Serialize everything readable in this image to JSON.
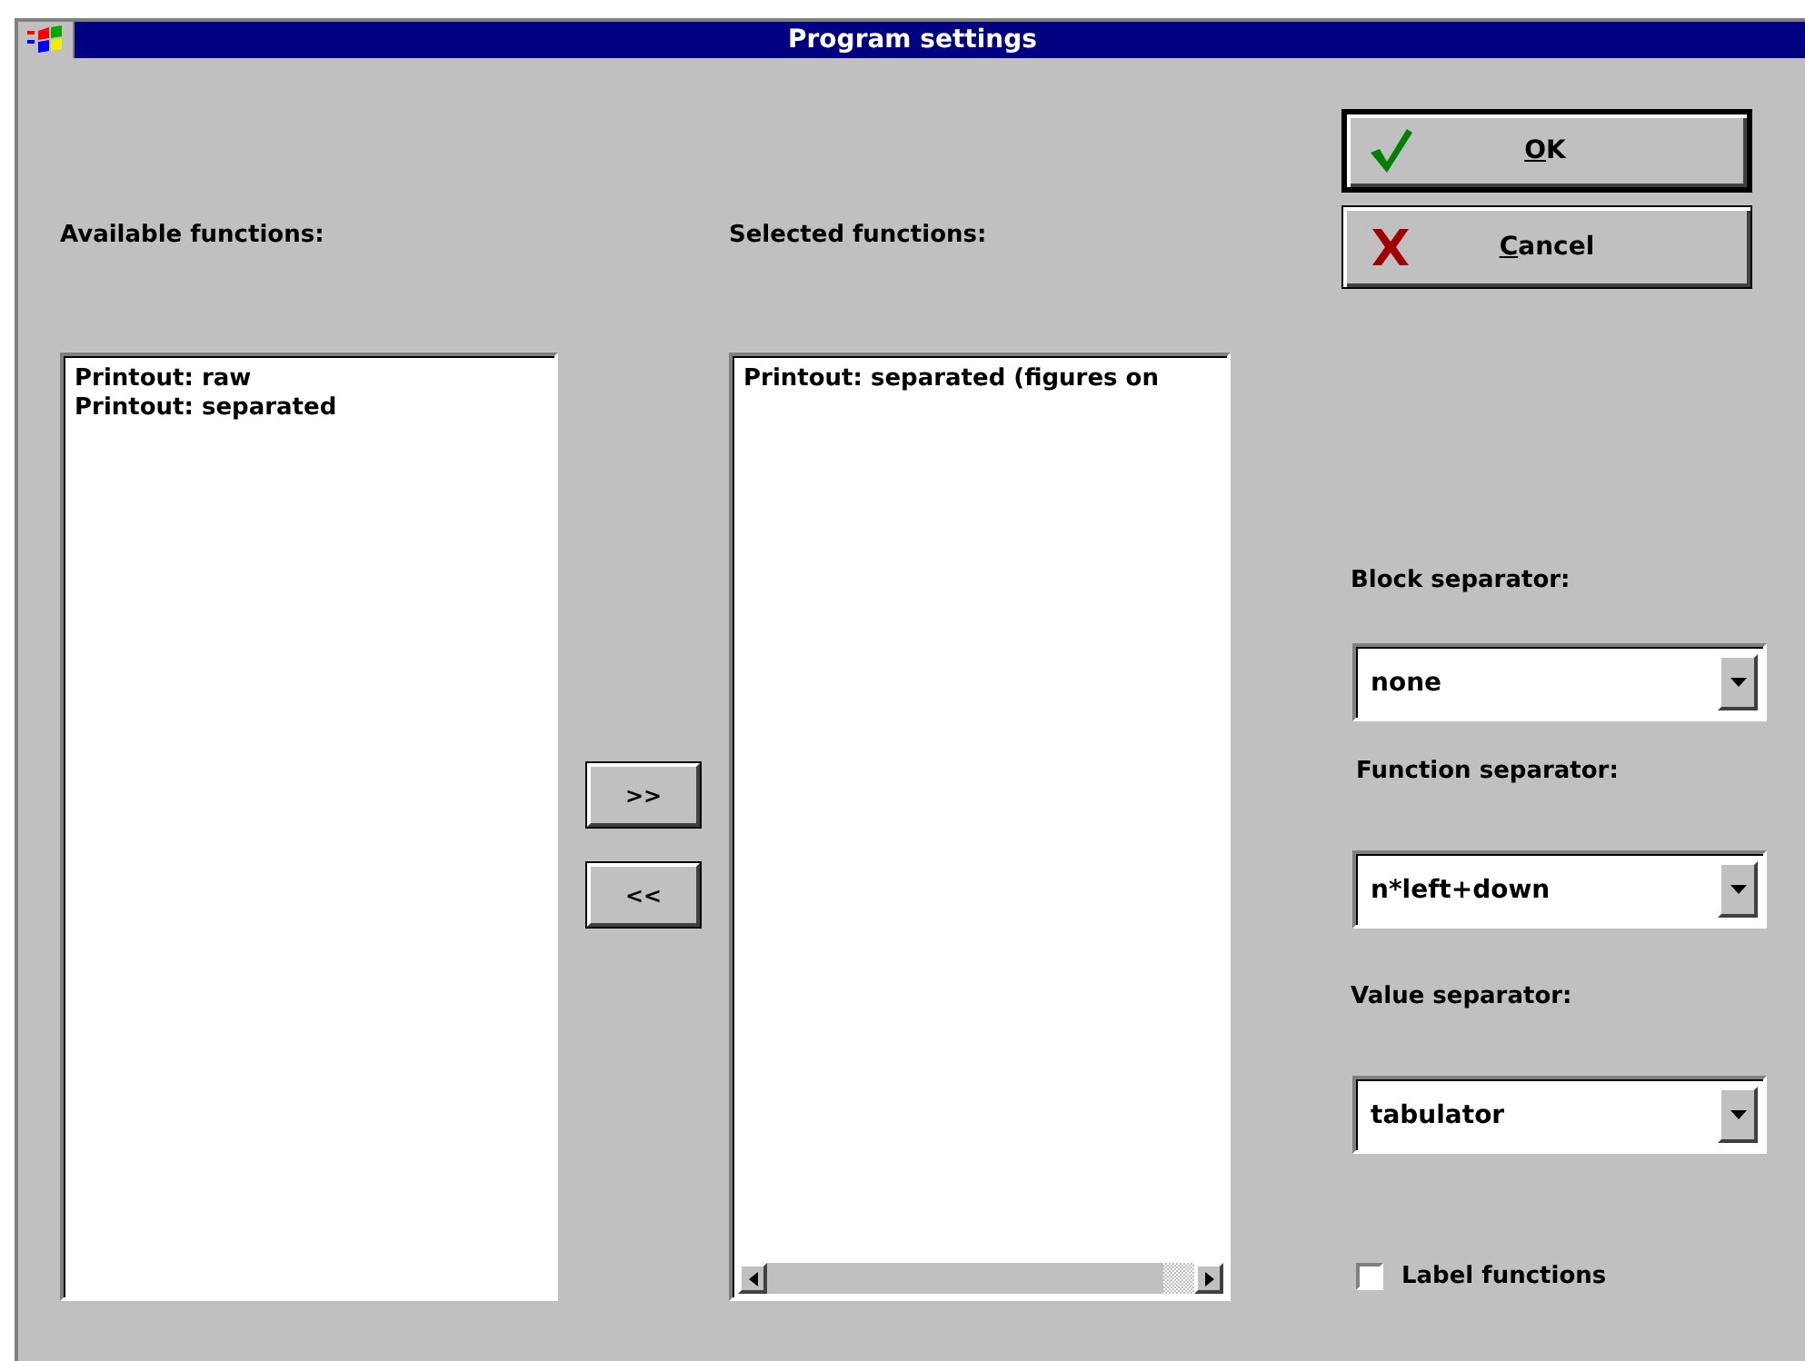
{
  "window": {
    "title": "Program settings"
  },
  "available": {
    "label": "Available functions:",
    "items": [
      {
        "text": "Printout: raw",
        "selected": false
      },
      {
        "text": "Printout: separated",
        "selected": false
      }
    ]
  },
  "transfer_buttons": [
    {
      "label": ">>"
    },
    {
      "label": "<<"
    }
  ],
  "selected": {
    "label": "Selected functions:",
    "items": [
      {
        "text": "Printout: separated (figures on",
        "selected": false
      }
    ]
  },
  "buttons": [
    {
      "kind": "ok",
      "mnemonic": "O",
      "label_rest": "K",
      "default": true
    },
    {
      "kind": "cancel",
      "mnemonic": "C",
      "label_rest": "ancel",
      "default": false
    }
  ],
  "separators": [
    {
      "label": "Block separator:",
      "value": "none"
    },
    {
      "label": "Function separator:",
      "value": "n*left+down"
    },
    {
      "label": "Value separator:",
      "value": "tabulator"
    }
  ],
  "label_functions": {
    "label": "Label functions",
    "checked": false
  }
}
